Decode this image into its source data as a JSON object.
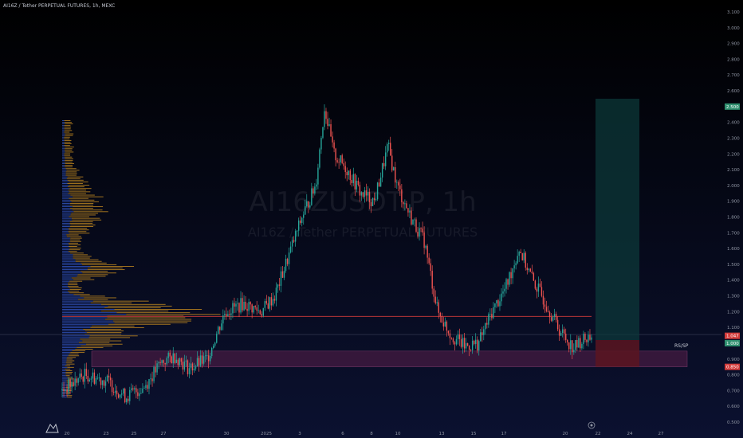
{
  "header": {
    "symbol_line": "AI16Z / Tether PERPETUAL FUTURES, 1h, MEXC"
  },
  "watermark": {
    "symbol": "AI16ZUSDT.P, 1h",
    "description": "AI16Z / Tether PERPETUAL FUTURES"
  },
  "position_label": "RS/SP",
  "colors": {
    "background": "#06091a",
    "up_candle": "#26a69a",
    "down_candle": "#ef5350",
    "volume_profile_up": "#2e4fb5",
    "volume_profile_down": "#b07d1f",
    "resistance_line": "#d23b3b",
    "support_zone": "#5a1f4a",
    "target_zone": "#0d3a3a",
    "stop_zone": "#5a1521",
    "axis_text": "#8f95a3"
  },
  "chart_data": {
    "type": "candlestick",
    "title": "",
    "y_axis": {
      "ticks": [
        "3.100",
        "3.000",
        "2.900",
        "2.800",
        "2.700",
        "2.600",
        "2.500",
        "2.400",
        "2.300",
        "2.200",
        "2.100",
        "2.000",
        "1.900",
        "1.800",
        "1.700",
        "1.600",
        "1.500",
        "1.400",
        "1.300",
        "1.200",
        "1.100",
        "1.000",
        "0.900",
        "0.800",
        "0.700",
        "0.600",
        "0.500"
      ],
      "range": [
        0.5,
        3.1
      ]
    },
    "x_axis": {
      "ticks": [
        "20",
        "23",
        "25",
        "27",
        "30",
        "2025",
        "3",
        "6",
        "8",
        "10",
        "13",
        "15",
        "17",
        "20",
        "22",
        "24",
        "27"
      ]
    },
    "price_path": [
      [
        0,
        0.7
      ],
      [
        5,
        0.8
      ],
      [
        10,
        0.76
      ],
      [
        14,
        0.66
      ],
      [
        18,
        0.72
      ],
      [
        22,
        0.88
      ],
      [
        25,
        0.92
      ],
      [
        28,
        0.84
      ],
      [
        32,
        0.9
      ],
      [
        36,
        1.2
      ],
      [
        40,
        1.25
      ],
      [
        44,
        1.2
      ],
      [
        47,
        1.3
      ],
      [
        50,
        1.55
      ],
      [
        53,
        1.8
      ],
      [
        56,
        2.0
      ],
      [
        58,
        2.5
      ],
      [
        60,
        2.2
      ],
      [
        63,
        2.1
      ],
      [
        66,
        1.95
      ],
      [
        69,
        1.9
      ],
      [
        72,
        2.25
      ],
      [
        74,
        2.0
      ],
      [
        77,
        1.8
      ],
      [
        80,
        1.65
      ],
      [
        83,
        1.2
      ],
      [
        86,
        1.05
      ],
      [
        89,
        0.98
      ],
      [
        92,
        1.0
      ],
      [
        95,
        1.2
      ],
      [
        98,
        1.35
      ],
      [
        101,
        1.6
      ],
      [
        104,
        1.4
      ],
      [
        107,
        1.25
      ],
      [
        110,
        1.08
      ],
      [
        113,
        0.97
      ],
      [
        115,
        1.02
      ],
      [
        117,
        1.05
      ]
    ],
    "resistance_level": 1.17,
    "support_zone": [
      0.85,
      0.95
    ],
    "position": {
      "entry": 1.02,
      "target": 2.55,
      "stop": 0.85
    },
    "price_axis_markers": {
      "target": "2.500",
      "current": "1.047",
      "entry": "1.000",
      "stop": "0.850"
    }
  }
}
